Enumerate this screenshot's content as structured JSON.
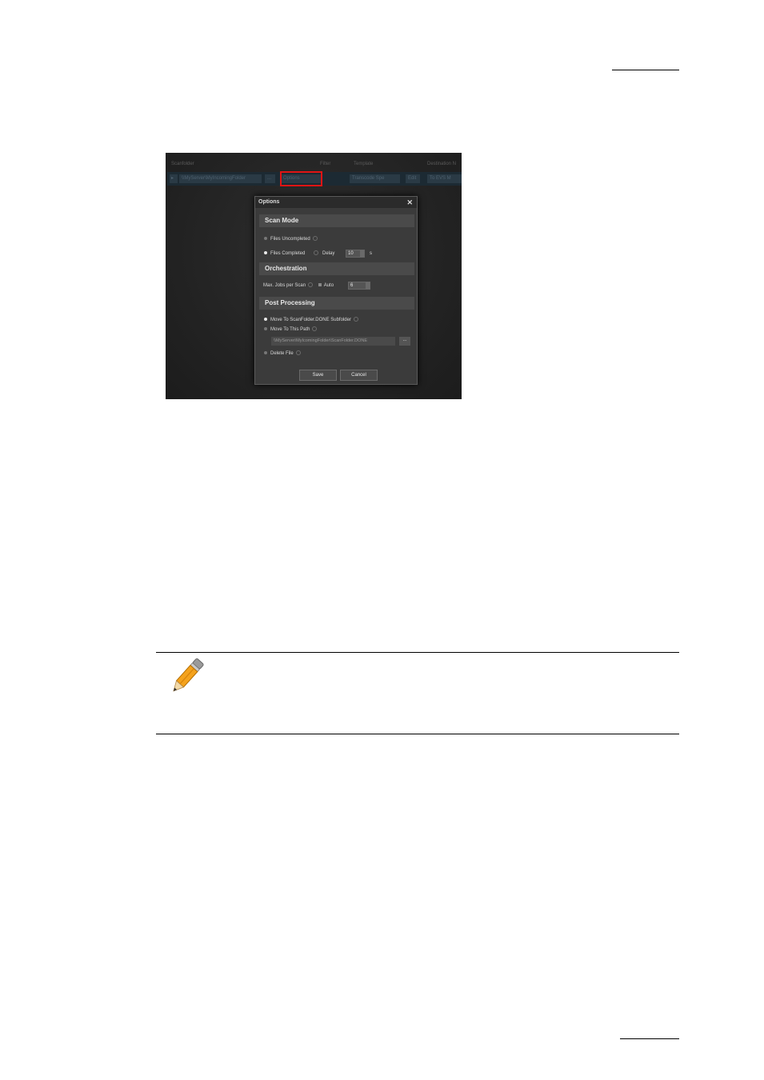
{
  "screenshot": {
    "headers": {
      "scanfolder": "Scanfolder",
      "filter": "Filter",
      "template": "Template",
      "destination": "Destination N"
    },
    "row": {
      "path": "\\\\MyServer\\MyIncomingFolder",
      "browse": "...",
      "options": "Options",
      "template": "Transcode Spe",
      "edit": "Edit",
      "destination": "To EVS M"
    },
    "dialog": {
      "title": "Options",
      "close": "✕",
      "scan_mode": {
        "heading": "Scan Mode",
        "files_uncompleted": "Files Uncompleted",
        "files_completed": "Files Completed",
        "delay_label": "Delay",
        "delay_value": "10",
        "delay_unit": "s"
      },
      "orchestration": {
        "heading": "Orchestration",
        "max_jobs_label": "Max. Jobs per Scan",
        "auto_label": "Auto",
        "max_jobs_value": "6"
      },
      "post_processing": {
        "heading": "Post Processing",
        "move_done": "Move To ScanFolder.DONE Subfolder",
        "move_path": "Move To This Path",
        "path_value": "\\\\MyServer\\MyIcomingFolder\\ScanFolder.DONE",
        "browse": "...",
        "delete_file": "Delete File"
      },
      "buttons": {
        "save": "Save",
        "cancel": "Cancel"
      }
    }
  },
  "note_icon": "pencil-icon"
}
